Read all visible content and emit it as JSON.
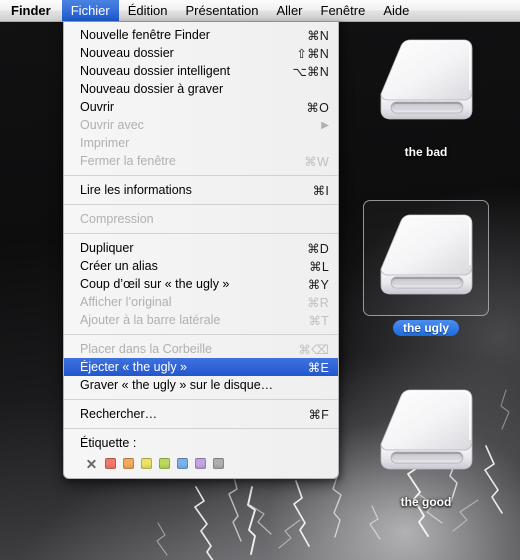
{
  "menubar": {
    "items": [
      {
        "name": "app-menu-finder",
        "label": "Finder",
        "active": false,
        "bold": true
      },
      {
        "name": "menu-fichier",
        "label": "Fichier",
        "active": true,
        "bold": false
      },
      {
        "name": "menu-edition",
        "label": "Édition",
        "active": false,
        "bold": false
      },
      {
        "name": "menu-presentation",
        "label": "Présentation",
        "active": false,
        "bold": false
      },
      {
        "name": "menu-aller",
        "label": "Aller",
        "active": false,
        "bold": false
      },
      {
        "name": "menu-fenetre",
        "label": "Fenêtre",
        "active": false,
        "bold": false
      },
      {
        "name": "menu-aide",
        "label": "Aide",
        "active": false,
        "bold": false
      }
    ]
  },
  "file_menu": {
    "groups": [
      {
        "items": [
          {
            "name": "menu-item-nouvelle-fenetre-finder",
            "label": "Nouvelle fenêtre Finder",
            "shortcut": "⌘N",
            "disabled": false,
            "selected": false,
            "submenu": false
          },
          {
            "name": "menu-item-nouveau-dossier",
            "label": "Nouveau dossier",
            "shortcut": "⇧⌘N",
            "disabled": false,
            "selected": false,
            "submenu": false
          },
          {
            "name": "menu-item-nouveau-dossier-intelligent",
            "label": "Nouveau dossier intelligent",
            "shortcut": "⌥⌘N",
            "disabled": false,
            "selected": false,
            "submenu": false
          },
          {
            "name": "menu-item-nouveau-dossier-a-graver",
            "label": "Nouveau dossier à graver",
            "shortcut": "",
            "disabled": false,
            "selected": false,
            "submenu": false
          },
          {
            "name": "menu-item-ouvrir",
            "label": "Ouvrir",
            "shortcut": "⌘O",
            "disabled": false,
            "selected": false,
            "submenu": false
          },
          {
            "name": "menu-item-ouvrir-avec",
            "label": "Ouvrir avec",
            "shortcut": "",
            "disabled": true,
            "selected": false,
            "submenu": true
          },
          {
            "name": "menu-item-imprimer",
            "label": "Imprimer",
            "shortcut": "",
            "disabled": true,
            "selected": false,
            "submenu": false
          },
          {
            "name": "menu-item-fermer-la-fenetre",
            "label": "Fermer la fenêtre",
            "shortcut": "⌘W",
            "disabled": true,
            "selected": false,
            "submenu": false
          }
        ]
      },
      {
        "items": [
          {
            "name": "menu-item-lire-les-informations",
            "label": "Lire les informations",
            "shortcut": "⌘I",
            "disabled": false,
            "selected": false,
            "submenu": false
          }
        ]
      },
      {
        "items": [
          {
            "name": "menu-item-compression",
            "label": "Compression",
            "shortcut": "",
            "disabled": true,
            "selected": false,
            "submenu": false
          }
        ]
      },
      {
        "items": [
          {
            "name": "menu-item-dupliquer",
            "label": "Dupliquer",
            "shortcut": "⌘D",
            "disabled": false,
            "selected": false,
            "submenu": false
          },
          {
            "name": "menu-item-creer-un-alias",
            "label": "Créer un alias",
            "shortcut": "⌘L",
            "disabled": false,
            "selected": false,
            "submenu": false
          },
          {
            "name": "menu-item-coup-doeil",
            "label": "Coup d’œil sur « the ugly »",
            "shortcut": "⌘Y",
            "disabled": false,
            "selected": false,
            "submenu": false
          },
          {
            "name": "menu-item-afficher-loriginal",
            "label": "Afficher l’original",
            "shortcut": "⌘R",
            "disabled": true,
            "selected": false,
            "submenu": false
          },
          {
            "name": "menu-item-ajouter-barre-laterale",
            "label": "Ajouter à la barre latérale",
            "shortcut": "⌘T",
            "disabled": true,
            "selected": false,
            "submenu": false
          }
        ]
      },
      {
        "items": [
          {
            "name": "menu-item-placer-dans-la-corbeille",
            "label": "Placer dans la Corbeille",
            "shortcut": "⌘⌫",
            "disabled": true,
            "selected": false,
            "submenu": false
          },
          {
            "name": "menu-item-ejecter",
            "label": "Éjecter « the ugly »",
            "shortcut": "⌘E",
            "disabled": false,
            "selected": true,
            "submenu": false
          },
          {
            "name": "menu-item-graver-sur-le-disque",
            "label": "Graver « the ugly » sur le disque…",
            "shortcut": "",
            "disabled": false,
            "selected": false,
            "submenu": false
          }
        ]
      },
      {
        "items": [
          {
            "name": "menu-item-rechercher",
            "label": "Rechercher…",
            "shortcut": "⌘F",
            "disabled": false,
            "selected": false,
            "submenu": false
          }
        ]
      }
    ],
    "label_section": {
      "title": "Étiquette :",
      "clear_name": "label-clear-none",
      "swatches": [
        {
          "name": "label-swatch-red",
          "color": "#f07a6a"
        },
        {
          "name": "label-swatch-orange",
          "color": "#f2ab5e"
        },
        {
          "name": "label-swatch-yellow",
          "color": "#ebe266"
        },
        {
          "name": "label-swatch-green",
          "color": "#bcd95e"
        },
        {
          "name": "label-swatch-blue",
          "color": "#7ab4ea"
        },
        {
          "name": "label-swatch-purple",
          "color": "#c3a4e2"
        },
        {
          "name": "label-swatch-gray",
          "color": "#aeaeae"
        }
      ]
    }
  },
  "desktop": {
    "drives": [
      {
        "name": "drive-icon-the-bad",
        "label": "the bad",
        "selected": false
      },
      {
        "name": "drive-icon-the-ugly",
        "label": "the ugly",
        "selected": true
      },
      {
        "name": "drive-icon-the-good",
        "label": "the good",
        "selected": false
      }
    ]
  },
  "colors": {
    "menubar_highlight": "#2257cd",
    "menu_selection": "#2257cd",
    "selection_badge": "#1c6ae0"
  }
}
